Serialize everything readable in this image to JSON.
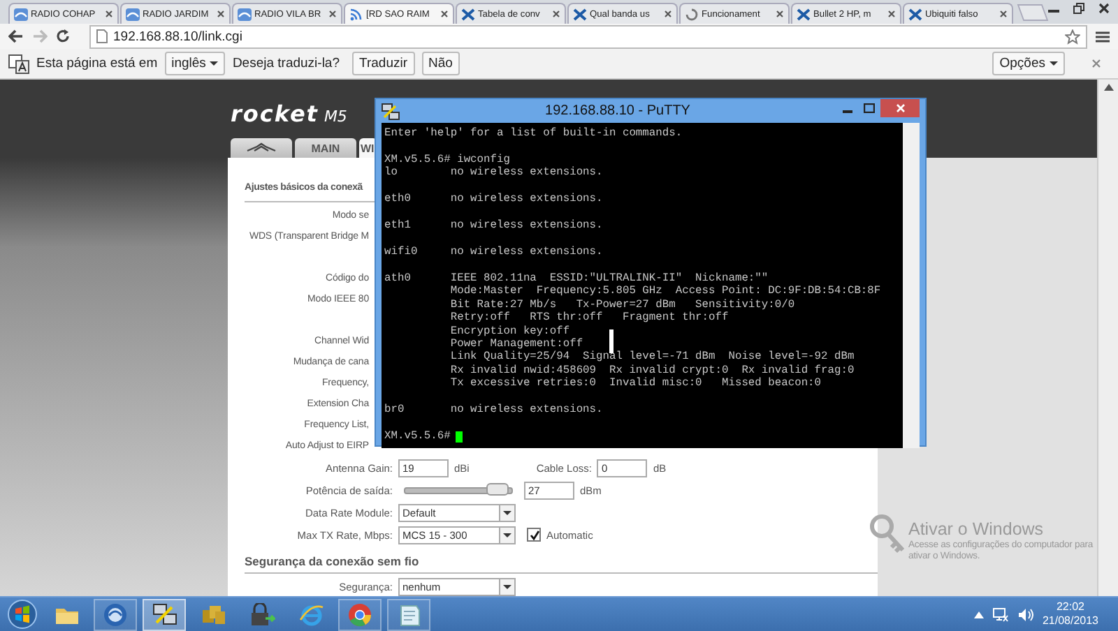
{
  "browser": {
    "tabs": [
      {
        "kind": "radio",
        "title": "RADIO COHAP",
        "selected": false
      },
      {
        "kind": "radio",
        "title": "RADIO JARDIM",
        "selected": false
      },
      {
        "kind": "radio",
        "title": "RADIO VILA BR",
        "selected": false
      },
      {
        "kind": "feed",
        "title": "[RD SAO RAIM",
        "selected": true
      },
      {
        "kind": "site",
        "title": "Tabela de conv",
        "selected": false
      },
      {
        "kind": "site",
        "title": "Qual banda us",
        "selected": false
      },
      {
        "kind": "loading",
        "title": "Funcionament",
        "selected": false
      },
      {
        "kind": "site",
        "title": "Bullet 2 HP, m",
        "selected": false
      },
      {
        "kind": "site",
        "title": "Ubiquiti falso",
        "selected": false
      }
    ],
    "url": "192.168.88.10/link.cgi"
  },
  "translate_bar": {
    "prefix": "Esta página está em",
    "language": "inglês",
    "question": "Deseja traduzi-la?",
    "translate_button": "Traduzir",
    "no_button": "Não",
    "options_button": "Opções"
  },
  "router_page": {
    "logo": {
      "name": "rocket",
      "model": "M5"
    },
    "tabs": [
      {
        "kind": "icon",
        "selected": false
      },
      {
        "kind": "text",
        "label": "MAIN",
        "selected": false
      },
      {
        "kind": "text",
        "label": "WI",
        "selected": true
      }
    ],
    "section_title": "Ajustes básicos da conexã",
    "label_groups": [
      [
        "Modo se",
        "WDS (Transparent Bridge M"
      ],
      [
        "Código do",
        "Modo IEEE 80"
      ],
      [
        "Channel Wid",
        "Mudança de cana",
        "Frequency,",
        "Extension Cha",
        "Frequency List,",
        "Auto Adjust to EIRP"
      ]
    ],
    "fields": [
      {
        "kind": "pair",
        "label": "Antenna Gain:",
        "value": "19",
        "unit": "dBi",
        "label_2": "Cable Loss:",
        "value_2": "0",
        "unit_2": "dB"
      },
      {
        "kind": "slider",
        "label": "Potência de saída:",
        "level": 0.97,
        "value": "27",
        "unit": "dBm"
      },
      {
        "kind": "select",
        "label": "Data Rate Module:",
        "value": "Default"
      },
      {
        "kind": "select_check",
        "label": "Max TX Rate, Mbps:",
        "value": "MCS 15 - 300",
        "check_label": "Automatic",
        "checked": true
      }
    ],
    "security_title": "Segurança da conexão sem fio",
    "security": {
      "label": "Segurança:",
      "value": "nenhum"
    }
  },
  "putty": {
    "title": "192.168.88.10 - PuTTY",
    "blocks": [
      [
        "Enter 'help' for a list of built-in commands."
      ],
      [
        "XM.v5.5.6# iwconfig",
        "lo        no wireless extensions."
      ],
      [
        "eth0      no wireless extensions."
      ],
      [
        "eth1      no wireless extensions."
      ],
      [
        "wifi0     no wireless extensions."
      ],
      [
        "ath0      IEEE 802.11na  ESSID:\"ULTRALINK-II\"  Nickname:\"\"",
        "          Mode:Master  Frequency:5.805 GHz  Access Point: DC:9F:DB:54:CB:8F",
        "          Bit Rate:27 Mb/s   Tx-Power=27 dBm   Sensitivity:0/0",
        "          Retry:off   RTS thr:off   Fragment thr:off",
        "          Encryption key:off",
        "          Power Management:off",
        "          Link Quality=25/94  Signal level=-71 dBm  Noise level=-92 dBm",
        "          Rx invalid nwid:458609  Rx invalid crypt:0  Rx invalid frag:0",
        "          Tx excessive retries:0  Invalid misc:0   Missed beacon:0"
      ],
      [
        "br0       no wireless extensions."
      ]
    ],
    "prompt": "XM.v5.5.6#"
  },
  "activation": {
    "title": "Ativar o Windows",
    "line_1": "Acesse as configurações do computador para",
    "line_2": "ativar o Windows."
  },
  "taskbar": {
    "apps": [
      {
        "kind": "folder",
        "running": false,
        "selected": false
      },
      {
        "kind": "winbox",
        "running": true,
        "selected": false
      },
      {
        "kind": "putty",
        "running": true,
        "selected": true
      },
      {
        "kind": "cubes",
        "running": false,
        "selected": false
      },
      {
        "kind": "lock",
        "running": false,
        "selected": false
      },
      {
        "kind": "ie",
        "running": false,
        "selected": false
      },
      {
        "kind": "chrome",
        "running": true,
        "selected": false
      },
      {
        "kind": "notepad",
        "running": true,
        "selected": false
      }
    ],
    "time": "22:02",
    "date": "21/08/2013"
  }
}
